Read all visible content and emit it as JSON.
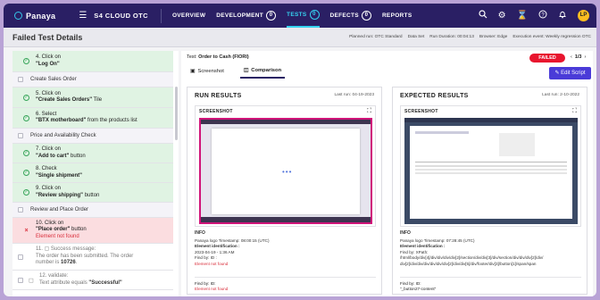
{
  "nav": {
    "brand": "Panaya",
    "project": "S4 CLOUD OTC",
    "items": [
      {
        "label": "OVERVIEW"
      },
      {
        "label": "DEVELOPMENT",
        "count": "0"
      },
      {
        "label": "TESTS",
        "count": "0",
        "active": true
      },
      {
        "label": "DEFECTS",
        "count": "0"
      },
      {
        "label": "REPORTS"
      }
    ],
    "avatar": "LP",
    "icons": [
      "search-icon",
      "settings-icon",
      "hourglass-icon",
      "help-icon",
      "bell-icon"
    ]
  },
  "header": {
    "title": "Failed Test Details",
    "planned_run": "Planned run: OTC Standard",
    "data_set": "Data Set",
    "run_duration": "Run Duration: 00:04:13",
    "browser": "Browser: Edge",
    "execution_event": "Execution event: Weekly regression OTC"
  },
  "steps": [
    {
      "type": "step",
      "line1": "4. Click on",
      "line2": "\"Log On\""
    },
    {
      "type": "sect",
      "label": "Create Sales Order"
    },
    {
      "type": "step",
      "line1": "5. Click on",
      "line2": "\"Create Sales Orders\"",
      "suffix": " Tile"
    },
    {
      "type": "step",
      "line1": "6. Select",
      "line2": "\"BTX motherboard\"",
      "suffix": " from the products list"
    },
    {
      "type": "sect",
      "label": "Price and Availability Check"
    },
    {
      "type": "step",
      "line1": "7. Click on",
      "line2": "\"Add to cart\"",
      "suffix": " button"
    },
    {
      "type": "step",
      "line1": "8. Check",
      "line2": "\"Single shipment\""
    },
    {
      "type": "step",
      "line1": "9. Click on",
      "line2": "\"Review shipping\"",
      "suffix": " button"
    },
    {
      "type": "sect",
      "label": "Review and Place Order"
    },
    {
      "type": "fail",
      "line1": "10. Click on",
      "line2": "\"Place order\"",
      "suffix": " button",
      "error": "Element not found"
    },
    {
      "type": "pend",
      "line1": "11. ▢ Success message:",
      "line2": "The order has been submitted. The order",
      "line3": "number is ",
      "bold3": "10726",
      "end3": "."
    },
    {
      "type": "pend",
      "line1": "12. validate:",
      "line2": "Text attribute equals ",
      "bold2": "\"Successful\""
    }
  ],
  "right": {
    "test_label": "Test:",
    "test_name": "Order to Cash (FIORI)",
    "status": "FAILED",
    "pager": "1/3",
    "edit_label": "Edit Script",
    "tabs": [
      {
        "label": "Screenshot"
      },
      {
        "label": "Comparison",
        "active": true
      }
    ],
    "run": {
      "title": "RUN RESULTS",
      "last_run": "Last run: 04-19-2023",
      "screenshot_label": "SCREENSHOT",
      "info_title": "INFO",
      "timestamp": "Panaya logo Timestamp: 08:00:15 (UTC)",
      "element_id_label": "Element identification :",
      "element_id_lines": [
        "2023-04-19 - 1:36 AM",
        "Find by: ID :"
      ],
      "element_status": "Element not found",
      "foot1": "Find by: ID:",
      "foot2": "Element not found"
    },
    "expected": {
      "title": "EXPECTED RESULTS",
      "last_run": "Last run: 2-10-2022",
      "screenshot_label": "SCREENSHOT",
      "info_title": "INFO",
      "timestamp": "Panaya logo Timestamp: 07:28:45 (UTC)",
      "element_id_label": "Element identification :",
      "element_id_lines": [
        "Find by: XPath:",
        "/html/body/div[4]/div/div/div/div[2]/section/div/div[3]/div/section/div/div/div[2]/div/",
        "div[2]/div/div/div/div/div/div[2]/div/div[5]/div/footer/div[3]/button[1]/span/span"
      ],
      "foot1": "Find by: ID:",
      "foot2": "\"_button27-content\""
    }
  }
}
